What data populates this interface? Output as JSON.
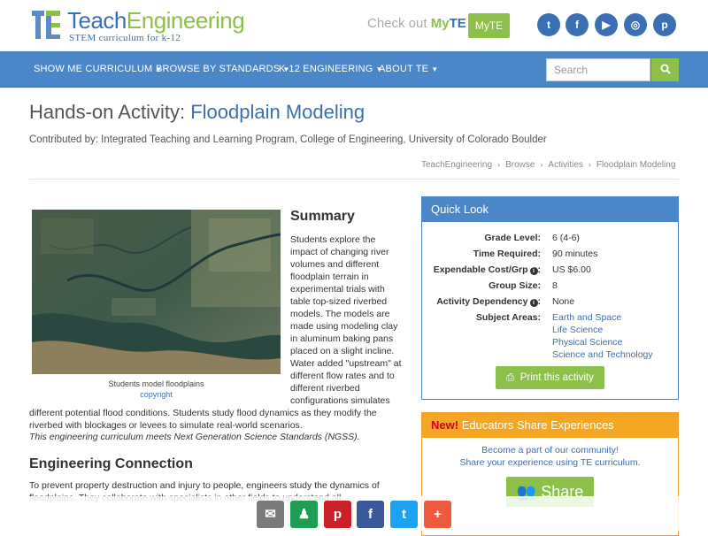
{
  "header": {
    "logo_prefix": "Teach",
    "logo_suffix": "Engineering",
    "logo_tagline": "STEM curriculum for k-12",
    "checkout_text": "Check out",
    "checkout_my": "My",
    "checkout_te": "TE",
    "myte_button": "MyTE",
    "social": [
      {
        "name": "twitter-icon",
        "glyph": "t"
      },
      {
        "name": "facebook-icon",
        "glyph": "f"
      },
      {
        "name": "youtube-icon",
        "glyph": "▶"
      },
      {
        "name": "instagram-icon",
        "glyph": "◎"
      },
      {
        "name": "pinterest-icon",
        "glyph": "p"
      }
    ]
  },
  "nav": {
    "items": [
      "SHOW ME CURRICULUM",
      "BROWSE BY STANDARDS",
      "K-12 ENGINEERING",
      "ABOUT TE"
    ],
    "search_placeholder": "Search"
  },
  "page": {
    "title_prefix": "Hands-on Activity:",
    "title_name": "Floodplain Modeling",
    "contributed": "Contributed by: Integrated Teaching and Learning Program, College of Engineering, University of Colorado Boulder",
    "breadcrumb": [
      "TeachEngineering",
      "Browse",
      "Activities",
      "Floodplain Modeling"
    ]
  },
  "figure": {
    "caption": "Students model floodplains",
    "copyright": "copyright"
  },
  "summary": {
    "heading": "Summary",
    "text_col": "Students explore the impact of changing river volumes and different floodplain terrain in experimental trials with table top-sized riverbed models. The models are made using modeling clay in aluminum baking pans placed on a slight incline. Water added \"upstream\" at different flow rates and to different riverbed configurations simulates",
    "text_full": "different potential flood conditions. Students study flood dynamics as they modify the riverbed with blockages or levees to simulate real-world scenarios.",
    "ngss": "This engineering curriculum meets Next Generation Science Standards (NGSS)."
  },
  "engineering": {
    "heading": "Engineering Connection",
    "text": "To prevent property destruction and injury to people, engineers study the dynamics of floodplains. They collaborate with specialists in other fields to understand all"
  },
  "quick_look": {
    "heading": "Quick Look",
    "rows": [
      {
        "label": "Grade Level:",
        "value": "6 (4-6)"
      },
      {
        "label": "Time Required:",
        "value": "90 minutes"
      },
      {
        "label": "Expendable Cost/Grp",
        "value": "US $6.00"
      },
      {
        "label": "Group Size:",
        "value": "8"
      },
      {
        "label": "Activity Dependency",
        "value": "None"
      }
    ],
    "subject_label": "Subject Areas:",
    "subjects": [
      "Earth and Space",
      "Life Science",
      "Physical Science",
      "Science and Technology"
    ],
    "print_button": "Print this activity"
  },
  "educators": {
    "new_tag": "New!",
    "heading": "Educators Share Experiences",
    "line1": "Become a part of our community!",
    "line2": "Share your experience using TE curriculum.",
    "share_button": "Share"
  },
  "sharebar": [
    {
      "name": "email-share-icon",
      "glyph": "✉",
      "color": "#7a7a7a"
    },
    {
      "name": "google-classroom-share-icon",
      "glyph": "♟",
      "color": "#1f9d55"
    },
    {
      "name": "pinterest-share-icon",
      "glyph": "p",
      "color": "#cb2027"
    },
    {
      "name": "facebook-share-icon",
      "glyph": "f",
      "color": "#3b5998"
    },
    {
      "name": "twitter-share-icon",
      "glyph": "t",
      "color": "#1da1f2"
    },
    {
      "name": "more-share-icon",
      "glyph": "+",
      "color": "#f05a3c"
    }
  ]
}
